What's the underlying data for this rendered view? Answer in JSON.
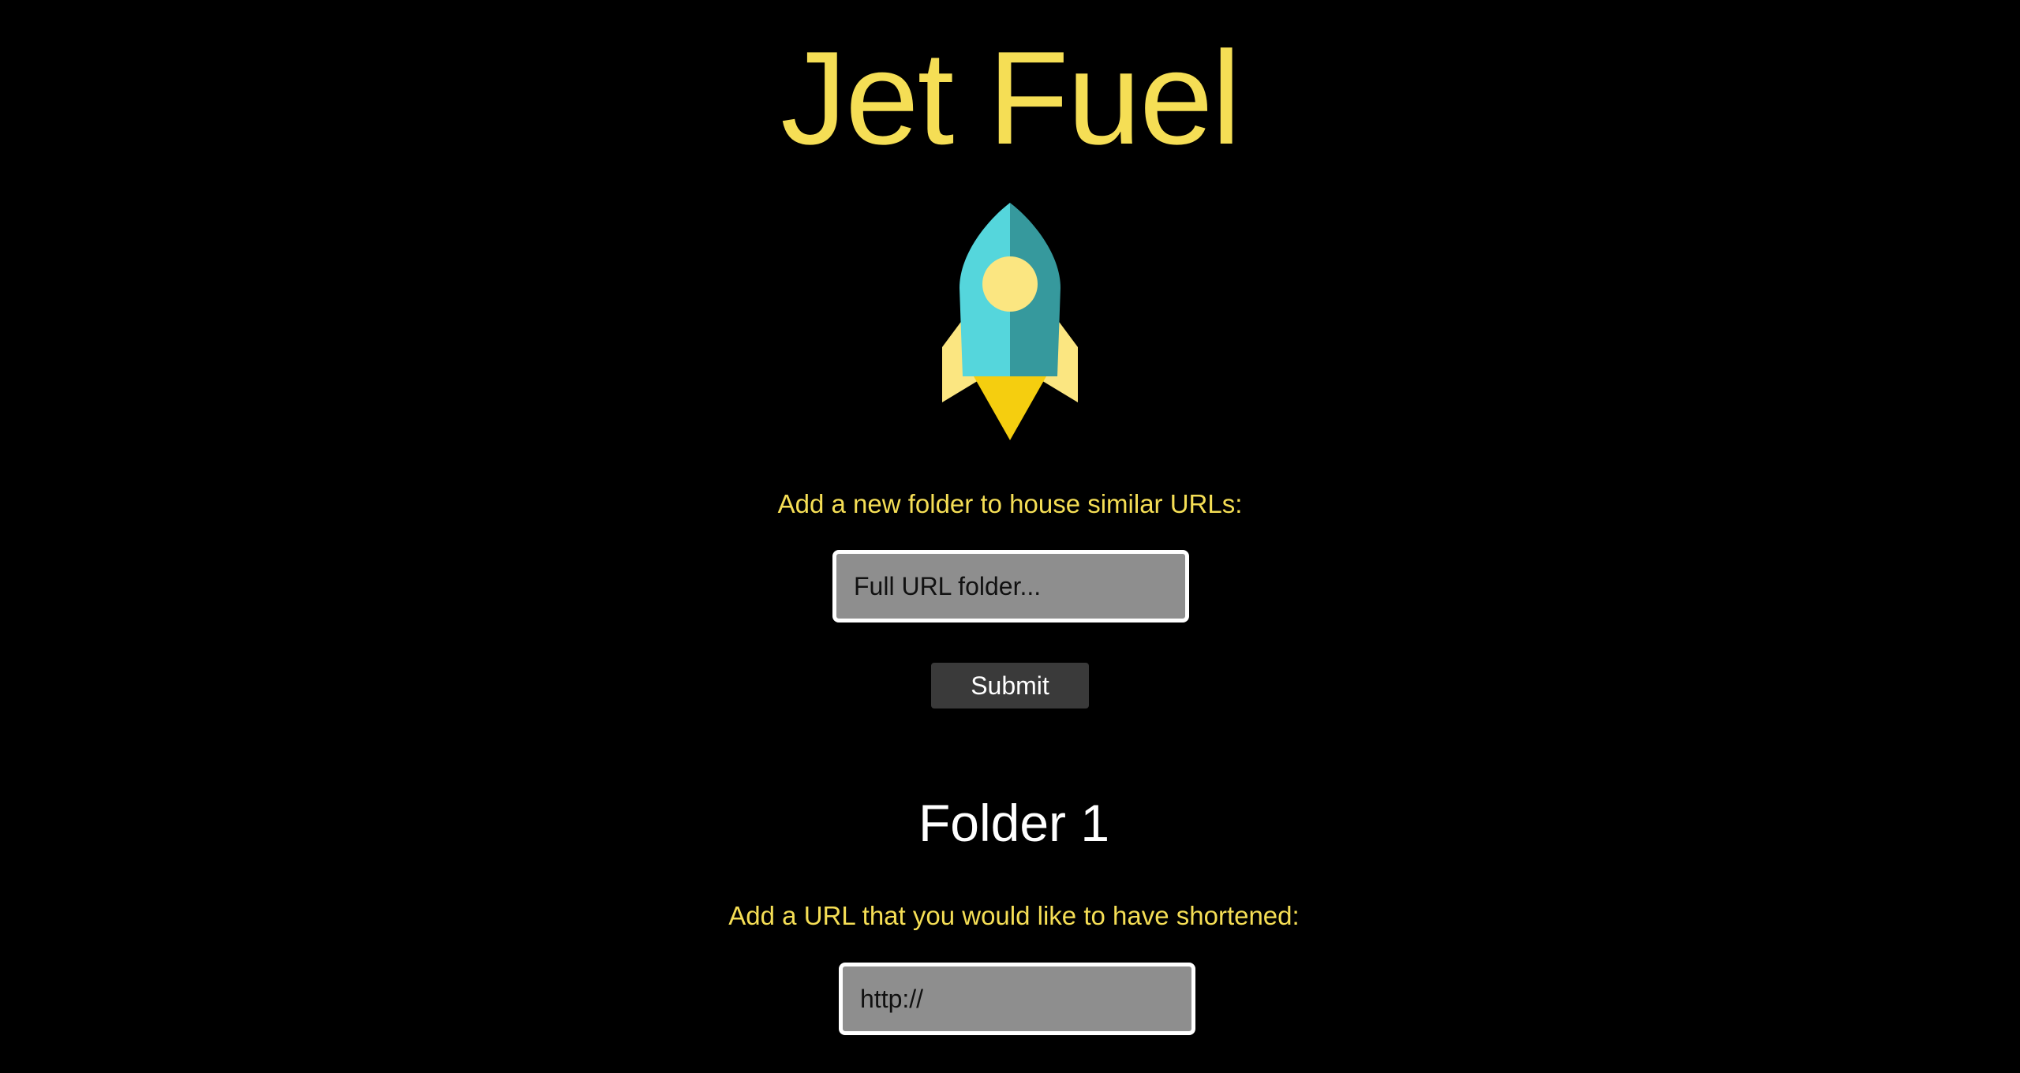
{
  "theme": {
    "background": "#000000",
    "accent": "#f5de55",
    "heading_text": "#ffffff",
    "input_bg": "#8e8e8e",
    "button_bg": "#3a3a3a",
    "rocket_teal_light": "#55d6dc",
    "rocket_teal_dark": "#36999d",
    "rocket_window": "#fbe681",
    "rocket_fins": "#fbe681",
    "rocket_flame": "#f5ce0f"
  },
  "header": {
    "title": "Jet Fuel",
    "logo_icon": "rocket-icon"
  },
  "folder_form": {
    "prompt": "Add a new folder to house similar URLs:",
    "input_value": "",
    "input_placeholder": "Full URL folder...",
    "submit_label": "Submit"
  },
  "folders": [
    {
      "title": "Folder 1",
      "url_prompt": "Add a URL that you would like to have shortened:",
      "url_input_value": "",
      "url_input_placeholder": "http://"
    }
  ]
}
